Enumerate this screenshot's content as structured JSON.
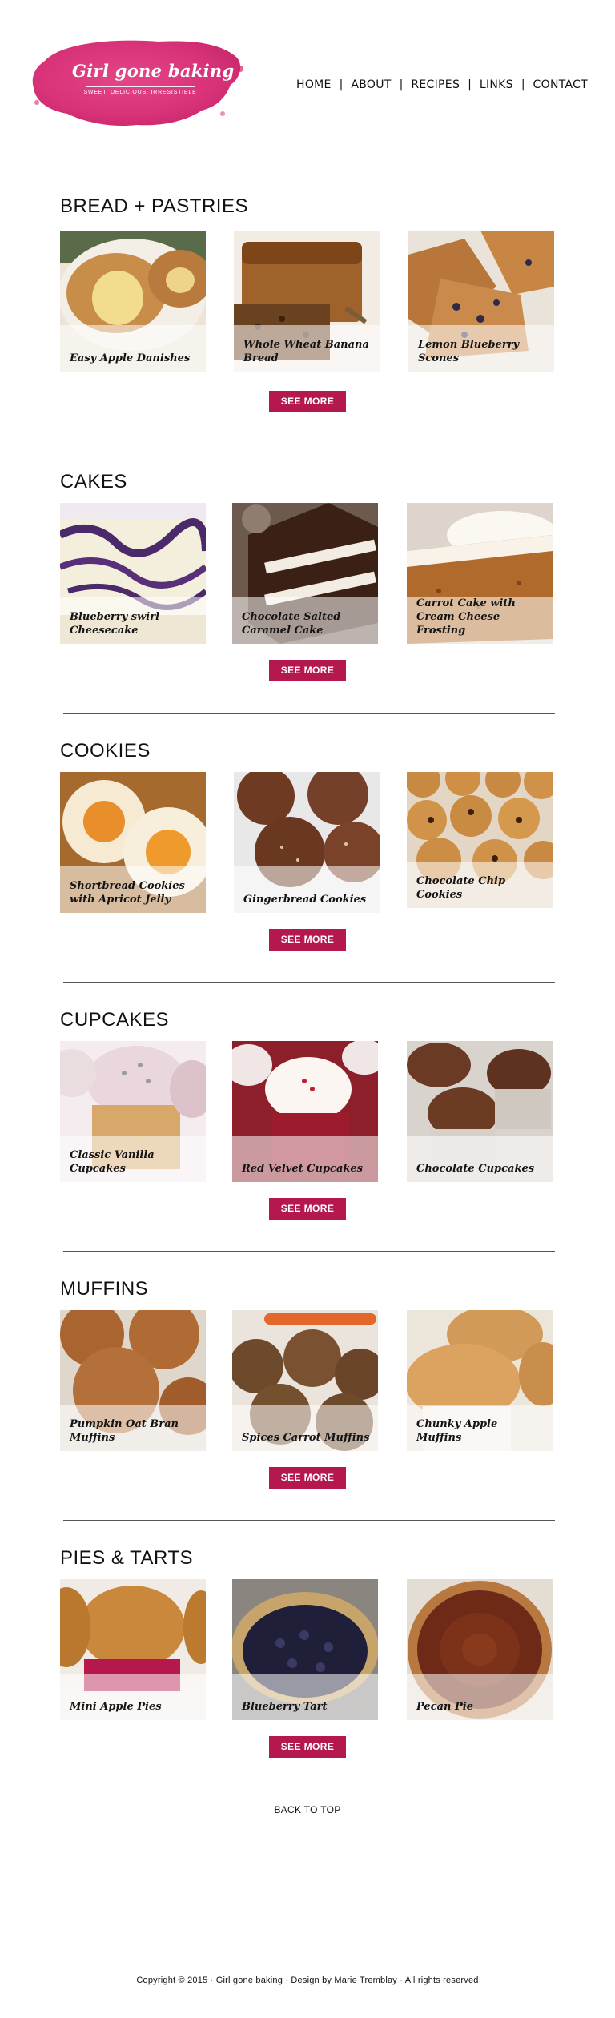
{
  "brand": {
    "name": "Girl gone baking",
    "tagline": "SWEET. DELICIOUS. IRRESISTIBLE",
    "accent": "#b5174f",
    "logo_pink": "#d6236e"
  },
  "nav": {
    "items": [
      "HOME",
      "ABOUT",
      "RECIPES",
      "LINKS",
      "CONTACT"
    ],
    "separator": "|"
  },
  "sections": [
    {
      "title": "BREAD + PASTRIES",
      "button": "SEE MORE",
      "cards": [
        {
          "caption": "Easy Apple Danishes",
          "icon": "danish-photo"
        },
        {
          "caption": "Whole Wheat Banana Bread",
          "icon": "banana-bread-photo"
        },
        {
          "caption": "Lemon Blueberry Scones",
          "icon": "scones-photo"
        }
      ]
    },
    {
      "title": "CAKES",
      "button": "SEE MORE",
      "cards": [
        {
          "caption": "Blueberry swirl Cheesecake",
          "icon": "cheesecake-photo"
        },
        {
          "caption": "Chocolate Salted Caramel Cake",
          "icon": "chocolate-cake-photo"
        },
        {
          "caption": "Carrot Cake with Cream Cheese Frosting",
          "icon": "carrot-cake-photo"
        }
      ]
    },
    {
      "title": "COOKIES",
      "button": "SEE MORE",
      "cards": [
        {
          "caption": "Shortbread Cookies with Apricot Jelly",
          "icon": "shortbread-photo"
        },
        {
          "caption": "Gingerbread Cookies",
          "icon": "gingerbread-photo"
        },
        {
          "caption": "Chocolate Chip Cookies",
          "icon": "chocolate-chip-photo"
        }
      ]
    },
    {
      "title": "CUPCAKES",
      "button": "SEE MORE",
      "cards": [
        {
          "caption": "Classic Vanilla Cupcakes",
          "icon": "vanilla-cupcake-photo"
        },
        {
          "caption": "Red Velvet Cupcakes",
          "icon": "red-velvet-photo"
        },
        {
          "caption": "Chocolate Cupcakes",
          "icon": "chocolate-cupcake-photo"
        }
      ]
    },
    {
      "title": "MUFFINS",
      "button": "SEE MORE",
      "cards": [
        {
          "caption": "Pumpkin Oat Bran Muffins",
          "icon": "pumpkin-muffin-photo"
        },
        {
          "caption": "Spices Carrot Muffins",
          "icon": "carrot-muffin-photo"
        },
        {
          "caption": "Chunky Apple Muffins",
          "icon": "apple-muffin-photo"
        }
      ]
    },
    {
      "title": "PIES & TARTS",
      "button": "SEE MORE",
      "cards": [
        {
          "caption": "Mini Apple Pies",
          "icon": "apple-pie-photo"
        },
        {
          "caption": "Blueberry Tart",
          "icon": "blueberry-tart-photo"
        },
        {
          "caption": "Pecan Pie",
          "icon": "pecan-pie-photo"
        }
      ]
    }
  ],
  "back_to_top": "BACK TO TOP",
  "footer": "Copyright © 2015 · Girl gone baking · Design by Marie Tremblay · All rights reserved"
}
